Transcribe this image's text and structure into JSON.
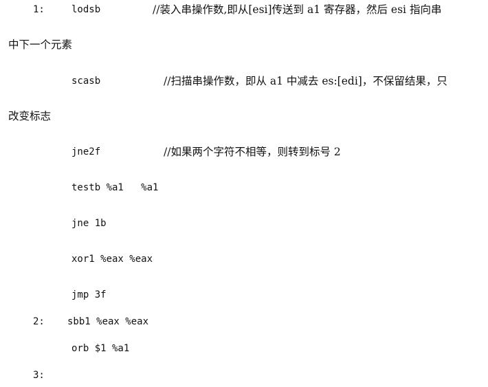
{
  "lines": [
    {
      "label": "1:",
      "code": "lodsb",
      "comment": "//装入串操作数,即从[esi]传送到 a1 寄存器，然后 esi 指向串"
    },
    {
      "continuation": "中下一个元素"
    },
    {
      "code": "scasb",
      "comment": "//扫描串操作数，即从 a1 中减去 es:[edi]，不保留结果，只"
    },
    {
      "continuation": "改变标志"
    },
    {
      "code": "jne2f",
      "comment": "//如果两个字符不相等，则转到标号 2"
    },
    {
      "code": "testb %a1   %a1"
    },
    {
      "code": "jne 1b"
    },
    {
      "code": "xor1 %eax %eax"
    },
    {
      "code": "jmp 3f"
    },
    {
      "label": "2:",
      "code": "sbb1 %eax %eax"
    },
    {
      "code": "orb $1 %a1"
    },
    {
      "label": "3:"
    }
  ]
}
